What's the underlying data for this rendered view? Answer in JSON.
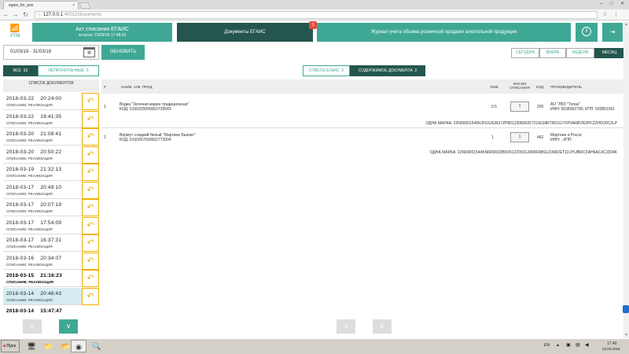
{
  "browser": {
    "tab_title": "egais_for_pos",
    "tab_close": "×",
    "url_host": "127.0.0.1",
    "url_rest": ":40012/documents",
    "win_min": "–",
    "win_max": "□",
    "win_close": "✕"
  },
  "header": {
    "logo_label": "УТМ",
    "act_title": "Акт списания ЕГАИС",
    "act_sub": "остаток: 23/03/18 17:48:03",
    "docs_label": "Документы ЕГАИС",
    "docs_badge": "3",
    "journal_label": "Журнал учета объема розничной продажи алкогольной продукции",
    "info_glyph": "i",
    "exit_glyph": "⇥"
  },
  "toolbar": {
    "date_range": "01/03/18 - 31/03/18",
    "refresh_label": "ОБНОВИТЬ",
    "periods": [
      "СЕГОДНЯ",
      "ВЧЕРА",
      "НЕДЕЛЯ",
      "МЕСЯЦ"
    ]
  },
  "filters": {
    "all_label": "ВСЕ",
    "all_count": "33",
    "unread_label": "НЕПРОЧИТАННЫЕ",
    "unread_count": "5"
  },
  "content_tabs": {
    "answers_label": "ОТВЕТЫ ЕГАИС",
    "answers_count": "2",
    "content_label": "СОДЕРЖИМОЕ ДОКУМЕНТА",
    "content_count": "2"
  },
  "list": {
    "header": "СПИСОК ДОКУМЕНТОВ",
    "items": [
      {
        "date": "2018-03-22",
        "time": "20:24:00",
        "kind": "СПИСАНИЕ: РЕАЛИЗАЦИЯ"
      },
      {
        "date": "2018-03-22",
        "time": "19:41:35",
        "kind": "СПИСАНИЕ: РЕАЛИЗАЦИЯ"
      },
      {
        "date": "2018-03-20",
        "time": "21:08:41",
        "kind": "СПИСАНИЕ: РЕАЛИЗАЦИЯ"
      },
      {
        "date": "2018-03-20",
        "time": "20:50:22",
        "kind": "СПИСАНИЕ: РЕАЛИЗАЦИЯ"
      },
      {
        "date": "2018-03-19",
        "time": "21:32:13",
        "kind": "СПИСАНИЕ: РЕАЛИЗАЦИЯ"
      },
      {
        "date": "2018-03-17",
        "time": "20:49:10",
        "kind": "СПИСАНИЕ: РЕАЛИЗАЦИЯ"
      },
      {
        "date": "2018-03-17",
        "time": "20:07:19",
        "kind": "СПИСАНИЕ: РЕАЛИЗАЦИЯ"
      },
      {
        "date": "2018-03-17",
        "time": "17:54:09",
        "kind": "СПИСАНИЕ: РЕАЛИЗАЦИЯ"
      },
      {
        "date": "2018-03-17",
        "time": "16:37:31",
        "kind": "СПИСАНИЕ: РЕАЛИЗАЦИЯ"
      },
      {
        "date": "2018-03-16",
        "time": "20:34:07",
        "kind": "СПИСАНИЕ: РЕАЛИЗАЦИЯ"
      },
      {
        "date": "2018-03-15",
        "time": "21:16:23",
        "kind": "СПИСАНИЕ: РЕАЛИЗАЦИЯ"
      },
      {
        "date": "2018-03-14",
        "time": "20:48:43",
        "kind": "СПИСАНИЕ: РЕАЛИЗАЦИЯ"
      },
      {
        "date": "2018-03-14",
        "time": "15:47:47",
        "kind": ""
      }
    ],
    "action_glyph": "↶",
    "pager_up": "∧",
    "pager_down": "∨"
  },
  "table": {
    "headers": {
      "num": "#",
      "name": "НАИМ. АЛК. ПРОД",
      "vol": "ЕМК.",
      "qty": "КОЛ-ВО СПИСАНИЯ",
      "code": "КОД",
      "maker": "ПРОИЗВОДИТЕЛЬ"
    },
    "rows": [
      {
        "n": "1",
        "name": "Водка \"Зеленая марка традиционная\"",
        "code_line": "КОД: 0150325000003729583",
        "vol": "0.5",
        "qty": "1",
        "kind_code": "200",
        "maker": "АО \"ЛВЗ \"Топаз\"",
        "maker_ids": "ИНН: 5038002790, КПП: 503801001",
        "mark": "ОДНА МАРКА: 22N00001545RJN1GIGN37ZP80123080025721IES8RTR01G7OPVA6BVR2PFZZH5O0C2LP"
      },
      {
        "n": "2",
        "name": "Вермут сладкий белый \"Мартини Бьянко\"",
        "code_line": "КОД: 0150367000002772004",
        "vol": "1",
        "qty": "1",
        "kind_code": "462",
        "maker": "Мартини и Росси",
        "maker_ids": "ИНН: , КПП:",
        "mark": "ОДНА МАРКА: 22N00001544KN6RD603B0V612200312499FRBGU1N6DET11UYUBRCXAH6AC4CZID4K"
      }
    ],
    "pager_up": "∧",
    "pager_down": "∨"
  },
  "taskbar": {
    "start_label": "Пуск",
    "lang": "EN",
    "clock_time": "17:40",
    "clock_date": "23.03.2018"
  }
}
